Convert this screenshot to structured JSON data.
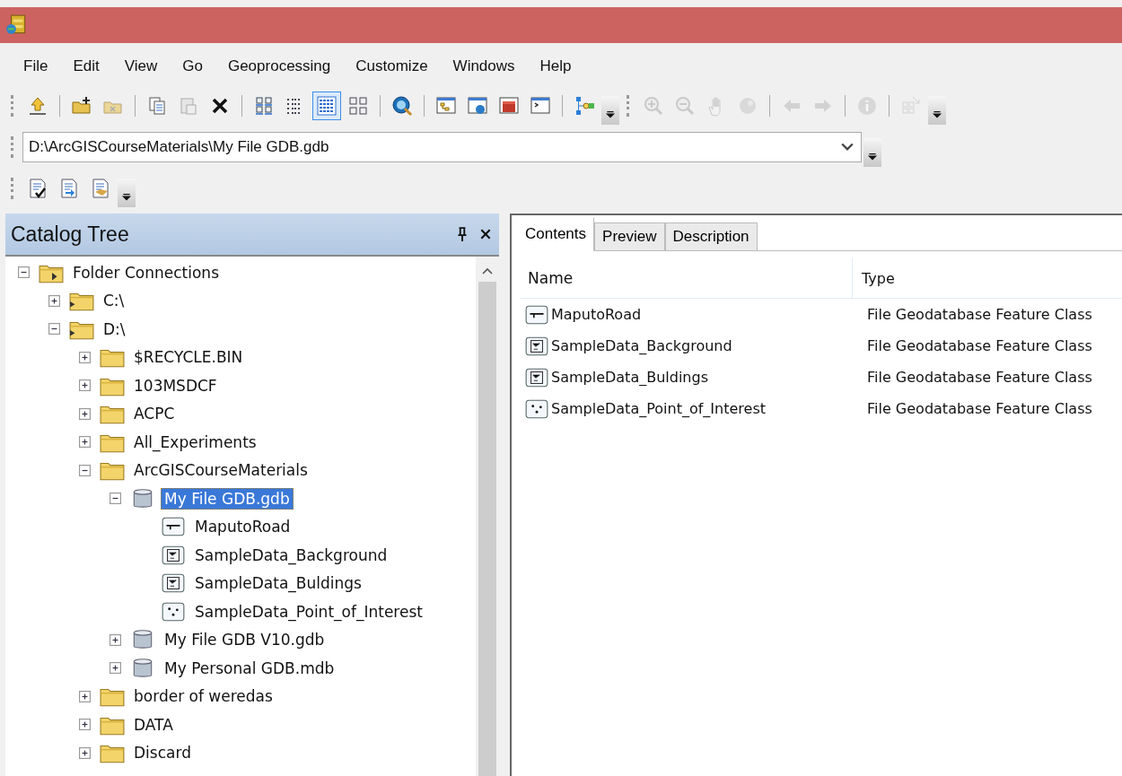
{
  "menu": [
    "File",
    "Edit",
    "View",
    "Go",
    "Geoprocessing",
    "Customize",
    "Windows",
    "Help"
  ],
  "toolbar_standard": [
    {
      "kind": "up",
      "disabled": false,
      "selected": false
    },
    {
      "kind": "separator"
    },
    {
      "kind": "connect-folder",
      "disabled": false,
      "selected": false
    },
    {
      "kind": "disconnect-folder",
      "disabled": true,
      "selected": false
    },
    {
      "kind": "separator"
    },
    {
      "kind": "copy",
      "disabled": false,
      "selected": false
    },
    {
      "kind": "paste",
      "disabled": true,
      "selected": false
    },
    {
      "kind": "delete",
      "disabled": false,
      "selected": false
    },
    {
      "kind": "separator"
    },
    {
      "kind": "large-icons",
      "disabled": false,
      "selected": false
    },
    {
      "kind": "list",
      "disabled": false,
      "selected": false
    },
    {
      "kind": "details",
      "disabled": false,
      "selected": true
    },
    {
      "kind": "thumbnails",
      "disabled": false,
      "selected": false
    },
    {
      "kind": "separator"
    },
    {
      "kind": "search",
      "disabled": false,
      "selected": false
    },
    {
      "kind": "separator"
    },
    {
      "kind": "tree-window",
      "disabled": false,
      "selected": false
    },
    {
      "kind": "globe-window",
      "disabled": false,
      "selected": false
    },
    {
      "kind": "toolbox",
      "disabled": false,
      "selected": false
    },
    {
      "kind": "python",
      "disabled": false,
      "selected": false
    },
    {
      "kind": "separator"
    },
    {
      "kind": "model",
      "disabled": false,
      "selected": false
    }
  ],
  "toolbar_geography": [
    {
      "kind": "zoom-in",
      "disabled": true,
      "selected": false
    },
    {
      "kind": "zoom-out",
      "disabled": true,
      "selected": false
    },
    {
      "kind": "pan",
      "disabled": true,
      "selected": false
    },
    {
      "kind": "full-extent",
      "disabled": true,
      "selected": false
    },
    {
      "kind": "separator"
    },
    {
      "kind": "back",
      "disabled": true,
      "selected": false
    },
    {
      "kind": "forward",
      "disabled": true,
      "selected": false
    },
    {
      "kind": "separator"
    },
    {
      "kind": "identify",
      "disabled": true,
      "selected": false
    },
    {
      "kind": "separator"
    },
    {
      "kind": "thumbnail",
      "disabled": true,
      "selected": false
    }
  ],
  "location": {
    "value": "D:\\ArcGISCourseMaterials\\My File GDB.gdb"
  },
  "toolbar_metadata": [
    {
      "kind": "validate"
    },
    {
      "kind": "import"
    },
    {
      "kind": "export"
    }
  ],
  "catalog_tree": {
    "title": "Catalog Tree",
    "items": [
      {
        "label": "Folder Connections",
        "kind": "folder-connections",
        "expanded": true,
        "selected": false,
        "children": [
          {
            "label": "C:\\",
            "kind": "drive",
            "expanded": false,
            "selected": false
          },
          {
            "label": "D:\\",
            "kind": "drive",
            "expanded": true,
            "selected": false,
            "children": [
              {
                "label": "$RECYCLE.BIN",
                "kind": "folder",
                "expanded": false,
                "selected": false
              },
              {
                "label": "103MSDCF",
                "kind": "folder",
                "expanded": false,
                "selected": false
              },
              {
                "label": "ACPC",
                "kind": "folder",
                "expanded": false,
                "selected": false
              },
              {
                "label": "All_Experiments",
                "kind": "folder",
                "expanded": false,
                "selected": false
              },
              {
                "label": "ArcGISCourseMaterials",
                "kind": "folder",
                "expanded": true,
                "selected": false,
                "children": [
                  {
                    "label": "My File GDB.gdb",
                    "kind": "geodatabase",
                    "expanded": true,
                    "selected": true,
                    "children": [
                      {
                        "label": "MaputoRoad",
                        "kind": "line",
                        "selected": false
                      },
                      {
                        "label": "SampleData_Background",
                        "kind": "polygon",
                        "selected": false
                      },
                      {
                        "label": "SampleData_Buldings",
                        "kind": "polygon",
                        "selected": false
                      },
                      {
                        "label": "SampleData_Point_of_Interest",
                        "kind": "point",
                        "selected": false
                      }
                    ]
                  },
                  {
                    "label": "My File GDB V10.gdb",
                    "kind": "geodatabase",
                    "expanded": false,
                    "selected": false
                  },
                  {
                    "label": "My Personal GDB.mdb",
                    "kind": "geodatabase",
                    "expanded": false,
                    "selected": false
                  }
                ]
              },
              {
                "label": "border of weredas",
                "kind": "folder",
                "expanded": false,
                "selected": false
              },
              {
                "label": "DATA",
                "kind": "folder",
                "expanded": false,
                "selected": false
              },
              {
                "label": "Discard",
                "kind": "folder",
                "expanded": false,
                "selected": false
              }
            ]
          }
        ]
      }
    ]
  },
  "tabs": [
    {
      "label": "Contents",
      "selected": true
    },
    {
      "label": "Preview",
      "selected": false
    },
    {
      "label": "Description",
      "selected": false
    }
  ],
  "contents": {
    "columns": [
      "Name",
      "Type"
    ],
    "rows": [
      {
        "name": "MaputoRoad",
        "kind": "line",
        "type": "File Geodatabase Feature Class"
      },
      {
        "name": "SampleData_Background",
        "kind": "polygon",
        "type": "File Geodatabase Feature Class"
      },
      {
        "name": "SampleData_Buldings",
        "kind": "polygon",
        "type": "File Geodatabase Feature Class"
      },
      {
        "name": "SampleData_Point_of_Interest",
        "kind": "point",
        "type": "File Geodatabase Feature Class"
      }
    ]
  }
}
